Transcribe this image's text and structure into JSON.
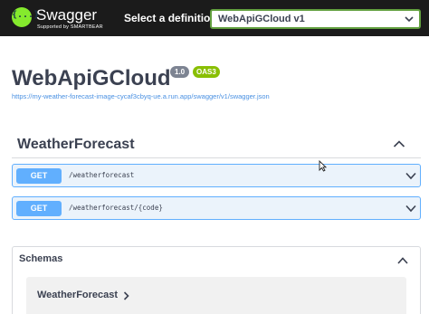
{
  "topbar": {
    "logo_glyph": "{...}",
    "brand_name": "Swagger",
    "brand_sub": "Supported by SMARTBEAR",
    "definition_label": "Select a definition",
    "definition_value": "WebApiGCloud v1",
    "accent_color": "#85ea2d"
  },
  "info": {
    "title": "WebApiGCloud",
    "version": "1.0",
    "oas": "OAS3",
    "spec_url": "https://my-weather-forecast-image-cycaf3cbyq-ue.a.run.app/swagger/v1/swagger.json"
  },
  "tag": {
    "name": "WeatherForecast",
    "operations": [
      {
        "method": "GET",
        "path": "/weatherforecast"
      },
      {
        "method": "GET",
        "path": "/weatherforecast/{code}"
      }
    ]
  },
  "schemas": {
    "title": "Schemas",
    "models": [
      {
        "name": "WeatherForecast"
      }
    ]
  },
  "colors": {
    "get_method": "#61affe",
    "get_background": "#ebf3fb",
    "link": "#4990e2",
    "oas_badge": "#89bf04",
    "version_badge": "#7d8492"
  }
}
